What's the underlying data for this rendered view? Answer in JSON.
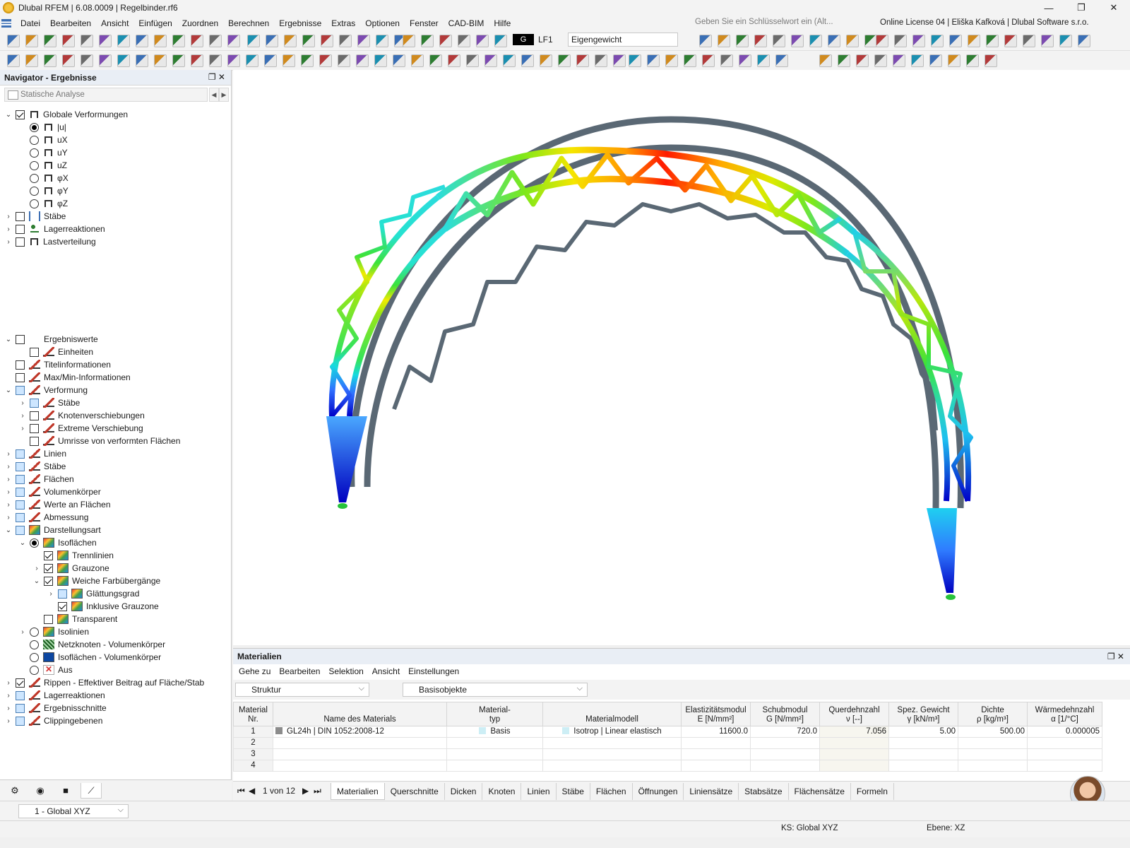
{
  "app": {
    "title": "Dlubal RFEM | 6.08.0009 | Regelbinder.rf6",
    "window_buttons": [
      "—",
      "❐",
      "✕"
    ]
  },
  "menu": [
    "Datei",
    "Bearbeiten",
    "Ansicht",
    "Einfügen",
    "Zuordnen",
    "Berechnen",
    "Ergebnisse",
    "Extras",
    "Optionen",
    "Fenster",
    "CAD-BIM",
    "Hilfe"
  ],
  "search": {
    "placeholder": "Geben Sie ein Schlüsselwort ein (Alt..."
  },
  "license": "Online License 04 | Eliška Kafková | Dlubal Software s.r.o.",
  "loadcase": {
    "tag": "G",
    "id": "LF1",
    "name": "Eigengewicht"
  },
  "navigator": {
    "title": "Navigator - Ergebnisse",
    "analysis": "Statische Analyse",
    "upper": [
      {
        "label": "Globale Verformungen",
        "level": 0,
        "expand": "⌄",
        "ctl": "cb",
        "state": "chk",
        "icon": "frame"
      },
      {
        "label": "|u|",
        "level": 1,
        "ctl": "rb",
        "state": "on",
        "icon": "frame"
      },
      {
        "label": "uX",
        "level": 1,
        "ctl": "rb",
        "icon": "frame"
      },
      {
        "label": "uY",
        "level": 1,
        "ctl": "rb",
        "icon": "frame"
      },
      {
        "label": "uZ",
        "level": 1,
        "ctl": "rb",
        "icon": "frame"
      },
      {
        "label": "φX",
        "level": 1,
        "ctl": "rb",
        "icon": "frame"
      },
      {
        "label": "φY",
        "level": 1,
        "ctl": "rb",
        "icon": "frame"
      },
      {
        "label": "φZ",
        "level": 1,
        "ctl": "rb",
        "icon": "frame"
      },
      {
        "label": "Stäbe",
        "level": 0,
        "expand": "›",
        "ctl": "cb",
        "icon": "stab"
      },
      {
        "label": "Lagerreaktionen",
        "level": 0,
        "expand": "›",
        "ctl": "cb",
        "icon": "lager"
      },
      {
        "label": "Lastverteilung",
        "level": 0,
        "expand": "›",
        "ctl": "cb",
        "icon": "frame"
      }
    ],
    "lower": [
      {
        "label": "Ergebniswerte",
        "level": 0,
        "expand": "⌄",
        "ctl": "cb",
        "icon": "xxx"
      },
      {
        "label": "Einheiten",
        "level": 1,
        "ctl": "cb",
        "icon": "res"
      },
      {
        "label": "Titelinformationen",
        "level": 0,
        "ctl": "cb",
        "icon": "res"
      },
      {
        "label": "Max/Min-Informationen",
        "level": 0,
        "ctl": "cb",
        "icon": "res"
      },
      {
        "label": "Verformung",
        "level": 0,
        "expand": "⌄",
        "ctl": "cb",
        "state": "part",
        "icon": "res"
      },
      {
        "label": "Stäbe",
        "level": 1,
        "expand": "›",
        "ctl": "cb",
        "state": "part",
        "icon": "res"
      },
      {
        "label": "Knotenverschiebungen",
        "level": 1,
        "expand": "›",
        "ctl": "cb",
        "icon": "res"
      },
      {
        "label": "Extreme Verschiebung",
        "level": 1,
        "expand": "›",
        "ctl": "cb",
        "icon": "res"
      },
      {
        "label": "Umrisse von verformten Flächen",
        "level": 1,
        "ctl": "cb",
        "icon": "res"
      },
      {
        "label": "Linien",
        "level": 0,
        "expand": "›",
        "ctl": "cb",
        "state": "part",
        "icon": "res"
      },
      {
        "label": "Stäbe",
        "level": 0,
        "expand": "›",
        "ctl": "cb",
        "state": "part",
        "icon": "res"
      },
      {
        "label": "Flächen",
        "level": 0,
        "expand": "›",
        "ctl": "cb",
        "state": "part",
        "icon": "res"
      },
      {
        "label": "Volumenkörper",
        "level": 0,
        "expand": "›",
        "ctl": "cb",
        "state": "part",
        "icon": "res"
      },
      {
        "label": "Werte an Flächen",
        "level": 0,
        "expand": "›",
        "ctl": "cb",
        "state": "part",
        "icon": "res"
      },
      {
        "label": "Abmessung",
        "level": 0,
        "expand": "›",
        "ctl": "cb",
        "state": "part",
        "icon": "res"
      },
      {
        "label": "Darstellungsart",
        "level": 0,
        "expand": "⌄",
        "ctl": "cb",
        "state": "part",
        "icon": "iso"
      },
      {
        "label": "Isoflächen",
        "level": 1,
        "expand": "⌄",
        "ctl": "rb",
        "state": "on",
        "icon": "iso"
      },
      {
        "label": "Trennlinien",
        "level": 2,
        "ctl": "cb",
        "state": "chk",
        "icon": "iso"
      },
      {
        "label": "Grauzone",
        "level": 2,
        "expand": "›",
        "ctl": "cb",
        "state": "chk",
        "icon": "iso"
      },
      {
        "label": "Weiche Farbübergänge",
        "level": 2,
        "expand": "⌄",
        "ctl": "cb",
        "state": "chk",
        "icon": "iso"
      },
      {
        "label": "Glättungsgrad",
        "level": 3,
        "expand": "›",
        "ctl": "cb",
        "state": "part",
        "icon": "iso"
      },
      {
        "label": "Inklusive Grauzone",
        "level": 3,
        "ctl": "cb",
        "state": "chk",
        "icon": "iso"
      },
      {
        "label": "Transparent",
        "level": 2,
        "ctl": "cb",
        "icon": "iso"
      },
      {
        "label": "Isolinien",
        "level": 1,
        "expand": "›",
        "ctl": "rb",
        "icon": "iso"
      },
      {
        "label": "Netzknoten - Volumenkörper",
        "level": 1,
        "ctl": "rb",
        "icon": "net"
      },
      {
        "label": "Isoflächen - Volumenkörper",
        "level": 1,
        "ctl": "rb",
        "icon": "volc"
      },
      {
        "label": "Aus",
        "level": 1,
        "ctl": "rb",
        "icon": "aus"
      },
      {
        "label": "Rippen - Effektiver Beitrag auf Fläche/Stab",
        "level": 0,
        "expand": "›",
        "ctl": "cb",
        "state": "chk",
        "icon": "res"
      },
      {
        "label": "Lagerreaktionen",
        "level": 0,
        "expand": "›",
        "ctl": "cb",
        "state": "part",
        "icon": "res"
      },
      {
        "label": "Ergebnisschnitte",
        "level": 0,
        "expand": "›",
        "ctl": "cb",
        "state": "part",
        "icon": "res"
      },
      {
        "label": "Clippingebenen",
        "level": 0,
        "expand": "›",
        "ctl": "cb",
        "state": "part",
        "icon": "res"
      }
    ]
  },
  "panel": {
    "title": "Materialien",
    "menu": [
      "Gehe zu",
      "Bearbeiten",
      "Selektion",
      "Ansicht",
      "Einstellungen"
    ],
    "combo1": "Struktur",
    "combo2": "Basisobjekte",
    "columns": [
      [
        "Material",
        "Nr."
      ],
      [
        "",
        "Name des Materials"
      ],
      [
        "Material-",
        "typ"
      ],
      [
        "",
        "Materialmodell"
      ],
      [
        "Elastizitätsmodul",
        "E [N/mm²]"
      ],
      [
        "Schubmodul",
        "G [N/mm²]"
      ],
      [
        "Querdehnzahl",
        "ν [--]"
      ],
      [
        "Spez. Gewicht",
        "γ [kN/m³]"
      ],
      [
        "Dichte",
        "ρ [kg/m³]"
      ],
      [
        "Wärmedehnzahl",
        "α [1/°C]"
      ]
    ],
    "rows": [
      [
        "1",
        "GL24h | DIN 1052:2008-12",
        "Basis",
        "Isotrop | Linear elastisch",
        "11600.0",
        "720.0",
        "7.056",
        "5.00",
        "500.00",
        "0.000005"
      ],
      [
        "2",
        "",
        "",
        "",
        "",
        "",
        "",
        "",
        "",
        ""
      ],
      [
        "3",
        "",
        "",
        "",
        "",
        "",
        "",
        "",
        "",
        ""
      ],
      [
        "4",
        "",
        "",
        "",
        "",
        "",
        "",
        "",
        "",
        ""
      ]
    ],
    "pager": "1 von 12",
    "tabs": [
      "Materialien",
      "Querschnitte",
      "Dicken",
      "Knoten",
      "Linien",
      "Stäbe",
      "Flächen",
      "Öffnungen",
      "Liniensätze",
      "Stabsätze",
      "Flächensätze",
      "Formeln"
    ]
  },
  "bottom": {
    "coord_system": "1 - Global XYZ"
  },
  "status": {
    "ks": "KS: Global XYZ",
    "ebene": "Ebene: XZ"
  }
}
